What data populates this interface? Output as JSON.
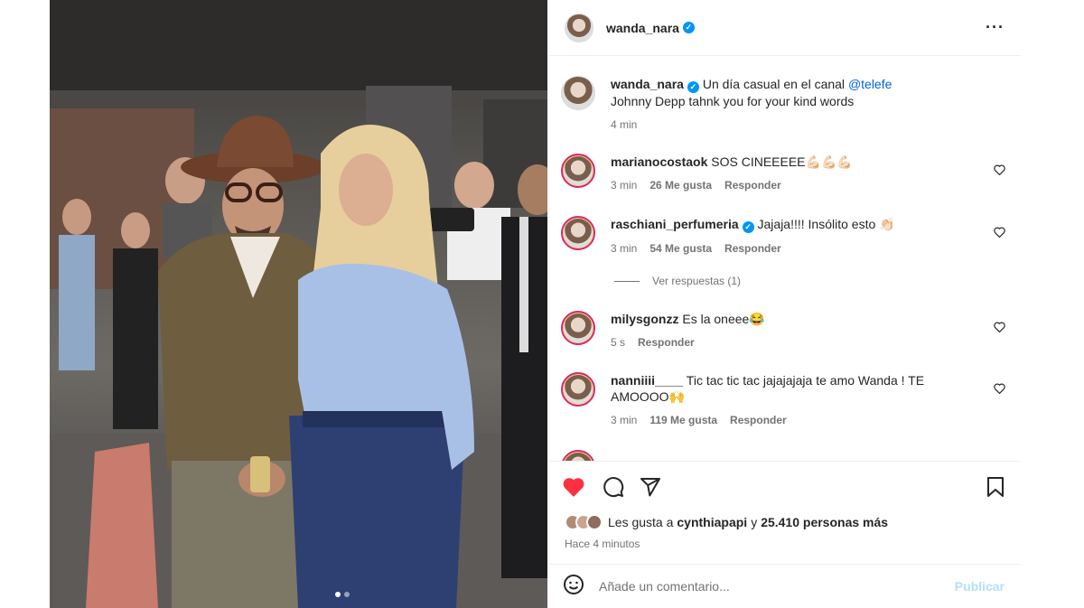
{
  "post": {
    "author": "wanda_nara",
    "caption_text": "Un día casual en el canal",
    "caption_mention": "@telefe",
    "caption_line2": "Johnny Depp tahnk you for your kind words",
    "caption_time": "4 min",
    "more_icon": "more-horizontal-icon",
    "carousel_next_icon": "chevron-right-icon",
    "carousel_dots": 2,
    "carousel_active_index": 0
  },
  "comments": [
    {
      "user": "marianocostaok",
      "verified": false,
      "text": "SOS CINEEEEE💪🏻💪🏻💪🏻",
      "time": "3 min",
      "likes": "26 Me gusta",
      "reply": "Responder"
    },
    {
      "user": "raschiani_perfumeria",
      "verified": true,
      "text": "Jajaja!!!! Insólito esto 👏🏻",
      "time": "3 min",
      "likes": "54 Me gusta",
      "reply": "Responder"
    },
    {
      "user": "milysgonzz",
      "verified": false,
      "text": "Es la oneee😂",
      "time": "5 s",
      "likes": "",
      "reply": "Responder"
    },
    {
      "user": "nanniiii____",
      "verified": false,
      "text": "Tic tac tic tac jajajajaja te amo Wanda ! TE AMOOOO🙌",
      "time": "3 min",
      "likes": "119 Me gusta",
      "reply": "Responder"
    }
  ],
  "view_replies": "Ver respuestas (1)",
  "actions": {
    "like_icon": "heart-filled-icon",
    "comment_icon": "comment-icon",
    "share_icon": "send-icon",
    "save_icon": "bookmark-icon",
    "like_color": "#ff3040"
  },
  "likes": {
    "prefix": "Les gusta a",
    "user": "cynthiapapi",
    "connector": "y",
    "count": "25.410 personas más"
  },
  "posted_time": "Hace 4 minutos",
  "comment_box": {
    "emoji_icon": "emoji-icon",
    "placeholder": "Añade un comentario...",
    "publish_label": "Publicar"
  }
}
